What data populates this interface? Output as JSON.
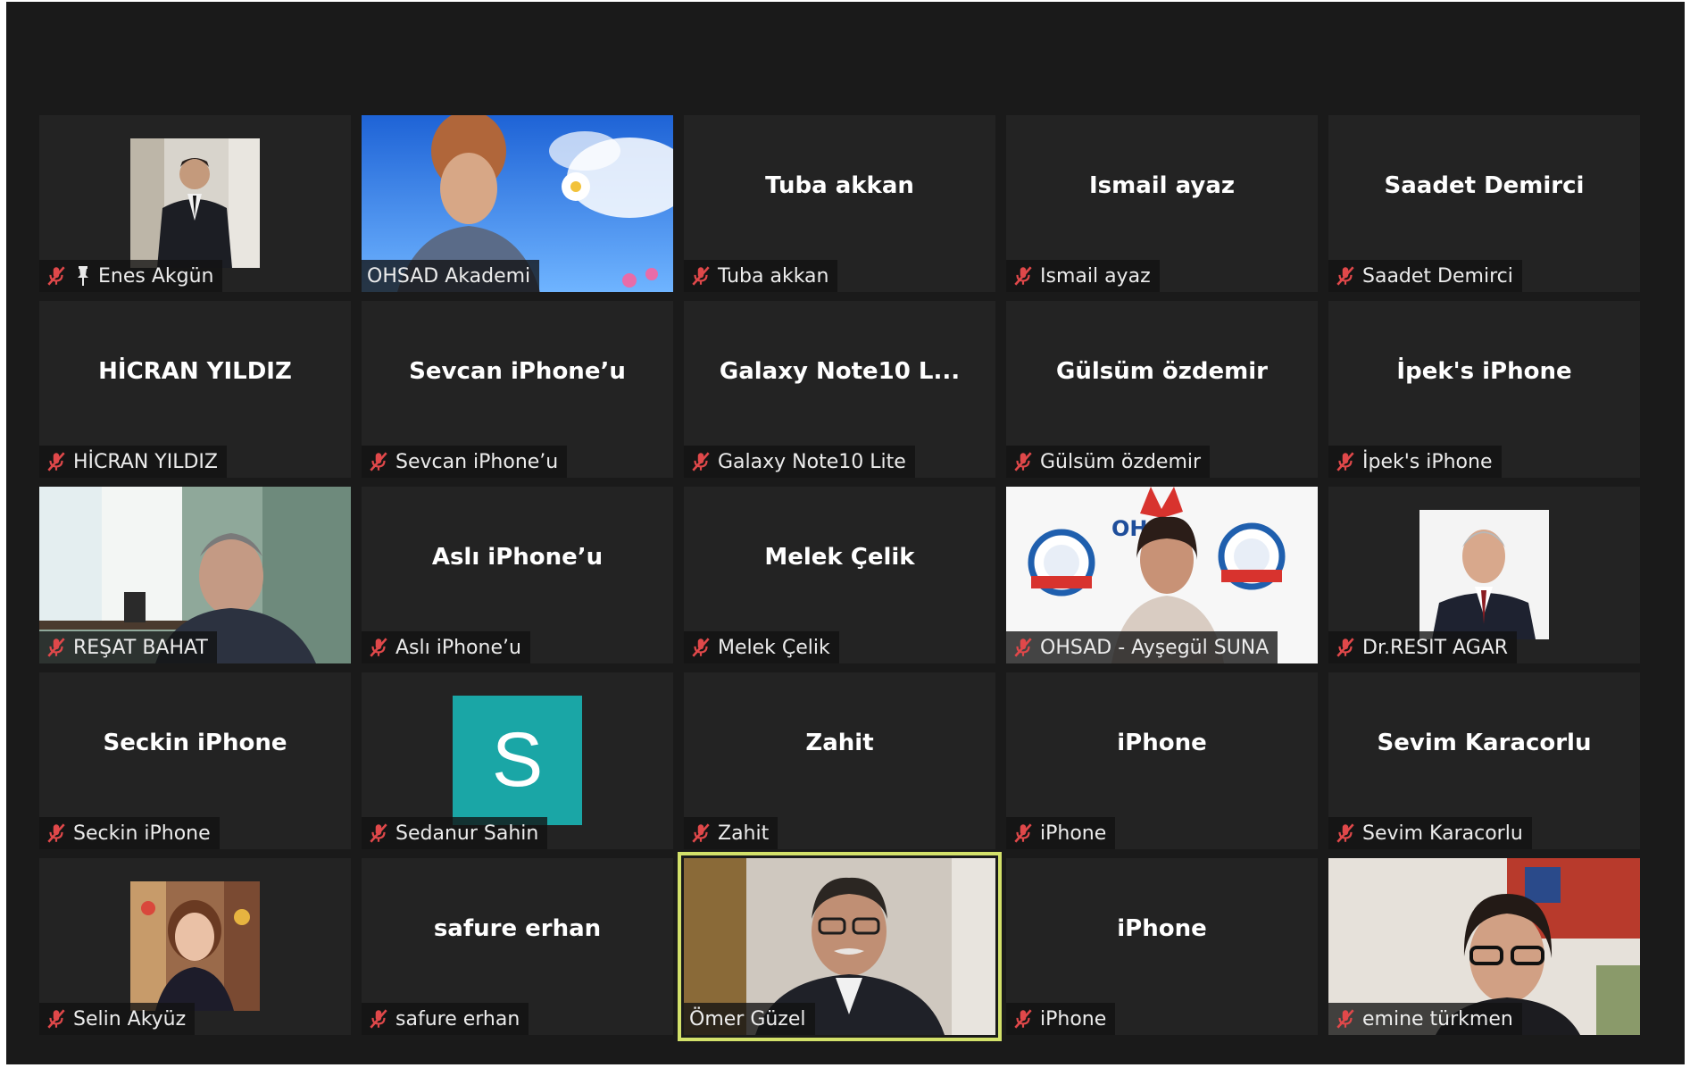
{
  "colors": {
    "background": "#1a1a1a",
    "tile": "#232323",
    "mute": "#e0484a",
    "active_speaker_border": "#d3e16a",
    "avatar_s": "#1aa6a6"
  },
  "participants": [
    {
      "label": "Enes Akgün",
      "pinned": true,
      "muted": true,
      "media": "profile-photo-man-suit"
    },
    {
      "label": "OHSAD Akademi",
      "muted": false,
      "media": "video-woman-sky-background"
    },
    {
      "display_name": "Tuba akkan",
      "label": "Tuba akkan",
      "muted": true
    },
    {
      "display_name": "Ismail ayaz",
      "label": "Ismail ayaz",
      "muted": true
    },
    {
      "display_name": "Saadet Demirci",
      "label": "Saadet Demirci",
      "muted": true
    },
    {
      "display_name": "HİCRAN YILDIZ",
      "label": "HİCRAN YILDIZ",
      "muted": true
    },
    {
      "display_name": "Sevcan iPhone’u",
      "label": "Sevcan iPhone’u",
      "muted": true
    },
    {
      "display_name": "Galaxy Note10 L...",
      "label": "Galaxy Note10 Lite",
      "muted": true
    },
    {
      "display_name": "Gülsüm özdemir",
      "label": "Gülsüm özdemir",
      "muted": true
    },
    {
      "display_name": "İpek's iPhone",
      "label": "İpek's iPhone",
      "muted": true
    },
    {
      "label": "REŞAT BAHAT",
      "muted": true,
      "media": "video-man-office"
    },
    {
      "display_name": "Aslı iPhone’u",
      "label": "Aslı iPhone’u",
      "muted": true
    },
    {
      "display_name": "Melek Çelik",
      "label": "Melek Çelik",
      "muted": true
    },
    {
      "label": "OHSAD - Ayşegül SUNA",
      "muted": true,
      "media": "video-woman-ohsad-logo-backdrop"
    },
    {
      "label": "Dr.RESIT AGAR",
      "muted": true,
      "media": "profile-photo-man-tie"
    },
    {
      "display_name": "Seckin iPhone",
      "label": "Seckin iPhone",
      "muted": true
    },
    {
      "label": "Sedanur Sahin",
      "muted": true,
      "avatar_letter": "S"
    },
    {
      "display_name": "Zahit",
      "label": "Zahit",
      "muted": true
    },
    {
      "display_name": "iPhone",
      "label": "iPhone",
      "muted": true
    },
    {
      "display_name": "Sevim Karacorlu",
      "label": "Sevim Karacorlu",
      "muted": true
    },
    {
      "label": "Selin Akyüz",
      "muted": true,
      "media": "profile-photo-woman"
    },
    {
      "display_name": "safure erhan",
      "label": "safure erhan",
      "muted": true
    },
    {
      "label": "Ömer Güzel",
      "muted": false,
      "speaking": true,
      "media": "video-older-man-glasses"
    },
    {
      "display_name": "iPhone",
      "label": "iPhone",
      "muted": true
    },
    {
      "label": "emine türkmen",
      "muted": true,
      "media": "video-woman-glasses"
    }
  ]
}
